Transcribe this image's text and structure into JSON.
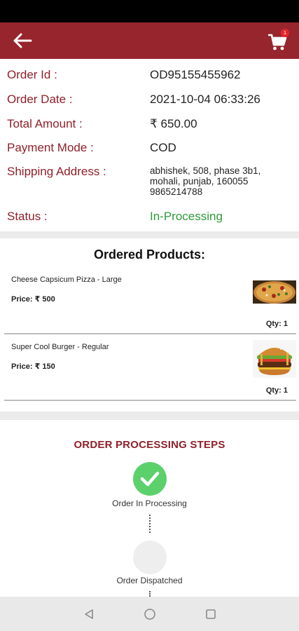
{
  "header": {
    "back_icon": "arrow-left-icon",
    "cart_icon": "cart-icon",
    "cart_badge": "1",
    "colors": {
      "app_bar": "#97252d",
      "badge": "#e8242b"
    }
  },
  "order": {
    "id_label": "Order Id :",
    "id_value": "OD95155455962",
    "date_label": "Order Date :",
    "date_value": "2021-10-04 06:33:26",
    "total_label": "Total Amount :",
    "total_value": "₹ 650.00",
    "payment_label": "Payment Mode :",
    "payment_value": "COD",
    "address_label": "Shipping Address :",
    "address_line1": "abhishek, 508, phase 3b1,",
    "address_line2": "mohali, punjab, 160055",
    "address_line3": "9865214788",
    "status_label": "Status :",
    "status_value": "In-Processing",
    "colors": {
      "label": "#8f2029",
      "status": "#2e9a3a"
    }
  },
  "products": {
    "title": "Ordered Products:",
    "items": [
      {
        "name": "Cheese Capsicum Pizza - Large",
        "price": "Price: ₹ 500",
        "qty": "Qty: 1",
        "image": "pizza-image"
      },
      {
        "name": "Super Cool Burger - Regular",
        "price": "Price: ₹ 150",
        "qty": "Qty: 1",
        "image": "burger-image"
      }
    ]
  },
  "steps": {
    "title": "ORDER PROCESSING STEPS",
    "items": [
      {
        "label": "Order In Processing",
        "state": "done",
        "icon": "check-icon"
      },
      {
        "label": "Order Dispatched",
        "state": "pending"
      }
    ],
    "colors": {
      "done": "#5cd06b",
      "pending": "#eeeeee",
      "title": "#8f2029"
    }
  },
  "nav": {
    "back_icon": "triangle-back-icon",
    "home_icon": "circle-home-icon",
    "recents_icon": "square-recents-icon"
  }
}
